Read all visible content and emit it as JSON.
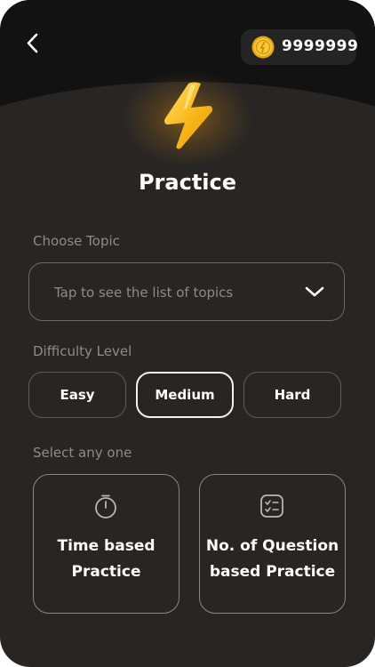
{
  "header": {
    "back_icon": "chevron-left-icon",
    "coins": {
      "icon": "coin-icon",
      "value": "9999999"
    },
    "hero_icon": "lightning-bolt-icon"
  },
  "title": "Practice",
  "topic": {
    "label": "Choose Topic",
    "placeholder": "Tap to see the list of topics",
    "icon": "chevron-down-icon"
  },
  "difficulty": {
    "label": "Difficulty Level",
    "options": [
      {
        "label": "Easy",
        "selected": false
      },
      {
        "label": "Medium",
        "selected": true
      },
      {
        "label": "Hard",
        "selected": false
      }
    ]
  },
  "mode": {
    "label": "Select any one",
    "options": [
      {
        "icon": "stopwatch-icon",
        "line1": "Time based",
        "line2": "Practice"
      },
      {
        "icon": "checklist-icon",
        "line1": "No. of Question",
        "line2": "based Practice"
      }
    ]
  },
  "colors": {
    "background": "#282523",
    "header": "#121212",
    "accent_yellow": "#f5b81c",
    "text_primary": "#ffffff",
    "text_muted": "#8e8b88"
  }
}
